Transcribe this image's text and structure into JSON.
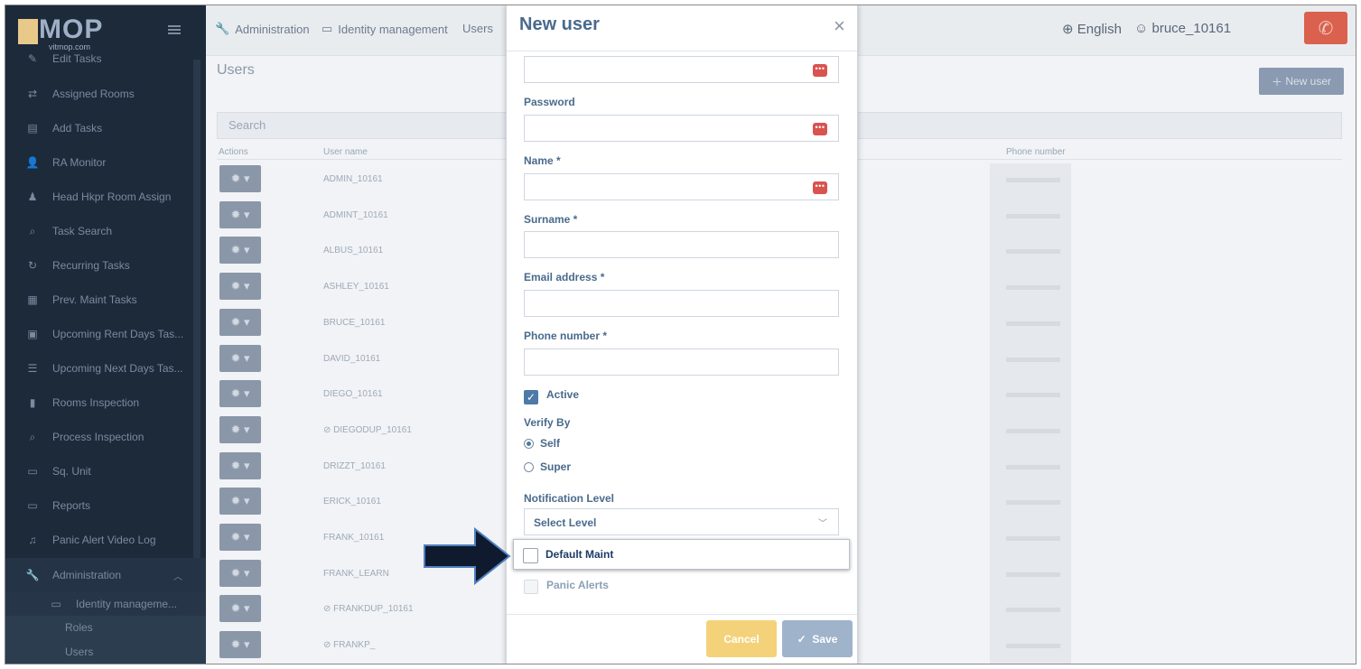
{
  "sidebar": {
    "logo": "MOP",
    "logo_sub": "vitmop.com",
    "items": [
      {
        "label": "Edit Tasks",
        "icon": "✎"
      },
      {
        "label": "Assigned Rooms",
        "icon": "⇄"
      },
      {
        "label": "Add Tasks",
        "icon": "▤"
      },
      {
        "label": "RA Monitor",
        "icon": "👤"
      },
      {
        "label": "Head Hkpr Room Assign",
        "icon": "♟"
      },
      {
        "label": "Task Search",
        "icon": "⌕"
      },
      {
        "label": "Recurring Tasks",
        "icon": "↻"
      },
      {
        "label": "Prev. Maint Tasks",
        "icon": "▦"
      },
      {
        "label": "Upcoming Rent Days Tas...",
        "icon": "▣"
      },
      {
        "label": "Upcoming Next Days Tas...",
        "icon": "☰"
      },
      {
        "label": "Rooms Inspection",
        "icon": "▮"
      },
      {
        "label": "Process Inspection",
        "icon": "⌕"
      },
      {
        "label": "Sq. Unit",
        "icon": "▭"
      },
      {
        "label": "Reports",
        "icon": "▭"
      },
      {
        "label": "Panic Alert Video Log",
        "icon": "♫"
      },
      {
        "label": "Administration",
        "icon": "🔧"
      },
      {
        "label": "Identity manageme...",
        "icon": "▭"
      },
      {
        "label": "Roles",
        "icon": ""
      },
      {
        "label": "Users",
        "icon": ""
      }
    ]
  },
  "topbar": {
    "crumb_admin": "Administration",
    "crumb_identity": "Identity management",
    "crumb_users": "Users",
    "language": "English",
    "username": "bruce_10161"
  },
  "main": {
    "title": "Users",
    "new_user_button": "New user",
    "search_placeholder": "Search",
    "columns": {
      "actions": "Actions",
      "username": "User name",
      "phone": "Phone number"
    },
    "rows": [
      {
        "user": "ADMIN_10161"
      },
      {
        "user": "ADMINT_10161"
      },
      {
        "user": "ALBUS_10161"
      },
      {
        "user": "ASHLEY_10161"
      },
      {
        "user": "BRUCE_10161"
      },
      {
        "user": "DAVID_10161"
      },
      {
        "user": "DIEGO_10161"
      },
      {
        "user": "DIEGODUP_10161"
      },
      {
        "user": "DRIZZT_10161"
      },
      {
        "user": "ERICK_10161"
      },
      {
        "user": "FRANK_10161"
      },
      {
        "user": "FRANK_LEARN"
      },
      {
        "user": "FRANKDUP_10161"
      },
      {
        "user": "FRANKP_"
      }
    ]
  },
  "modal": {
    "title": "New user",
    "password_label": "Password",
    "name_label": "Name *",
    "surname_label": "Surname *",
    "email_label": "Email address *",
    "phone_label": "Phone number *",
    "active_label": "Active",
    "verify_by_label": "Verify By",
    "verify_self": "Self",
    "verify_super": "Super",
    "notification_label": "Notification Level",
    "select_level": "Select Level",
    "default_maint": "Default Maint",
    "panic_alerts": "Panic Alerts",
    "cancel": "Cancel",
    "save": "Save"
  },
  "colors": {
    "accent": "#4d7aa6",
    "cancel": "#f3d27a",
    "save": "#9fb3cb",
    "phone_button": "#d9614e"
  }
}
